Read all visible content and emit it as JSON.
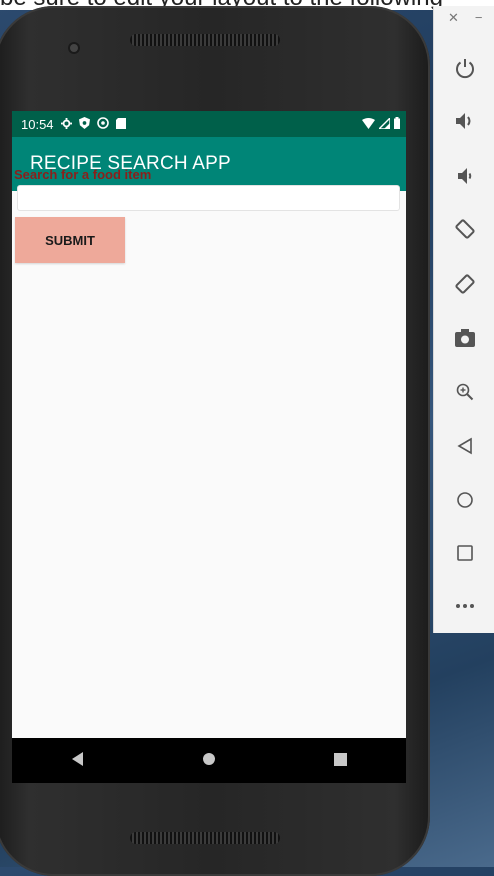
{
  "header_text": "be sure to edit your layout to the following",
  "status_bar": {
    "time": "10:54",
    "left_icons": [
      "settings-icon",
      "shield-icon",
      "sync-icon",
      "sd-card-icon"
    ],
    "right_icons": [
      "wifi-icon",
      "signal-icon",
      "battery-icon"
    ]
  },
  "app": {
    "title": "RECIPE SEARCH APP",
    "search_label": "Search for a food item",
    "search_value": "",
    "search_placeholder": "",
    "submit_label": "SUBMIT"
  },
  "navbar": [
    "back-icon",
    "home-icon",
    "recents-icon"
  ],
  "toolbar": {
    "window_controls": [
      "close-icon",
      "minimize-icon"
    ],
    "buttons": [
      "power-icon",
      "volume-up-icon",
      "volume-down-icon",
      "rotate-left-icon",
      "rotate-right-icon",
      "camera-icon",
      "zoom-icon",
      "back-icon",
      "home-icon",
      "overview-icon",
      "more-icon"
    ]
  },
  "colors": {
    "status_bar": "#00604a",
    "app_bar": "#008577",
    "label": "#8b1f1b",
    "submit_bg": "#eea99a"
  }
}
